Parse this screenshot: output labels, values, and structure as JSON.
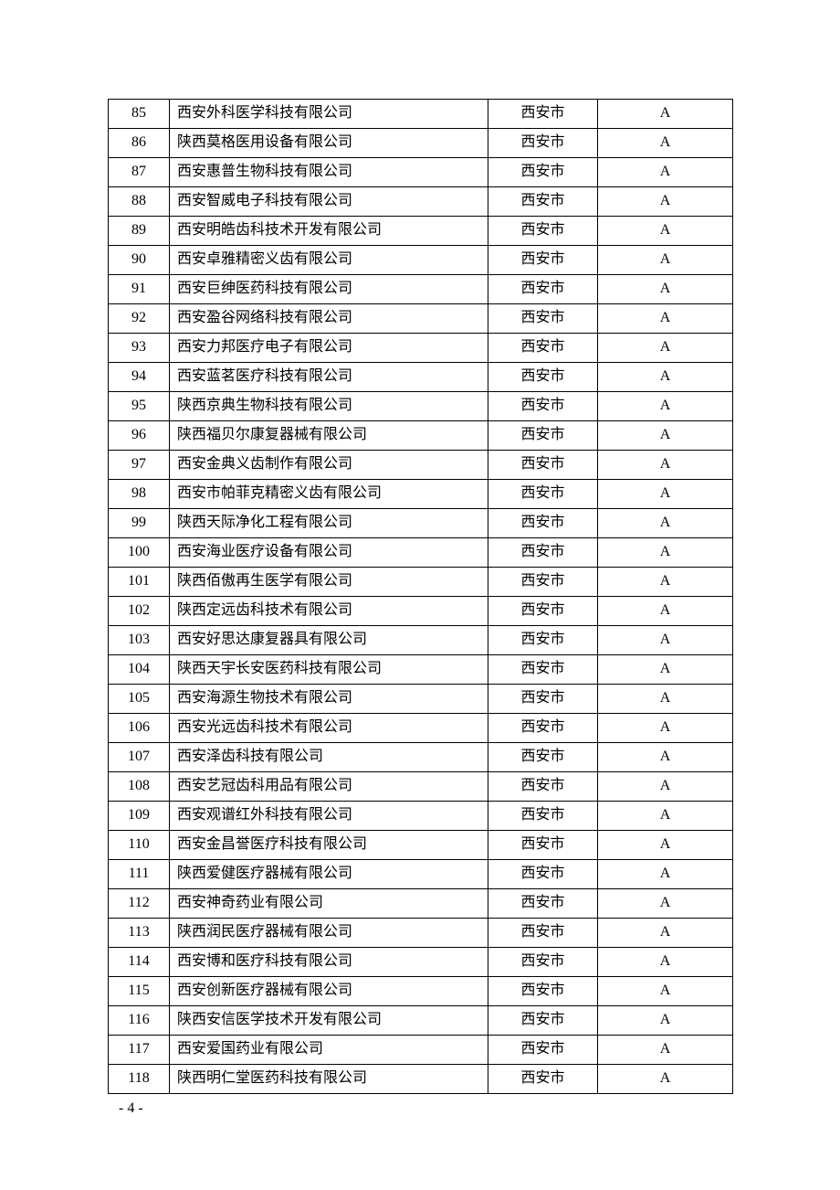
{
  "pageNumber": "- 4 -",
  "rows": [
    {
      "num": "85",
      "name": "西安外科医学科技有限公司",
      "city": "西安市",
      "grade": "A"
    },
    {
      "num": "86",
      "name": "陕西莫格医用设备有限公司",
      "city": "西安市",
      "grade": "A"
    },
    {
      "num": "87",
      "name": "西安惠普生物科技有限公司",
      "city": "西安市",
      "grade": "A"
    },
    {
      "num": "88",
      "name": "西安智威电子科技有限公司",
      "city": "西安市",
      "grade": "A"
    },
    {
      "num": "89",
      "name": "西安明皓齿科技术开发有限公司",
      "city": "西安市",
      "grade": "A"
    },
    {
      "num": "90",
      "name": "西安卓雅精密义齿有限公司",
      "city": "西安市",
      "grade": "A"
    },
    {
      "num": "91",
      "name": "西安巨绅医药科技有限公司",
      "city": "西安市",
      "grade": "A"
    },
    {
      "num": "92",
      "name": "西安盈谷网络科技有限公司",
      "city": "西安市",
      "grade": "A"
    },
    {
      "num": "93",
      "name": "西安力邦医疗电子有限公司",
      "city": "西安市",
      "grade": "A"
    },
    {
      "num": "94",
      "name": "西安蓝茗医疗科技有限公司",
      "city": "西安市",
      "grade": "A"
    },
    {
      "num": "95",
      "name": "陕西京典生物科技有限公司",
      "city": "西安市",
      "grade": "A"
    },
    {
      "num": "96",
      "name": "陕西福贝尔康复器械有限公司",
      "city": "西安市",
      "grade": "A"
    },
    {
      "num": "97",
      "name": "西安金典义齿制作有限公司",
      "city": "西安市",
      "grade": "A"
    },
    {
      "num": "98",
      "name": "西安市帕菲克精密义齿有限公司",
      "city": "西安市",
      "grade": "A"
    },
    {
      "num": "99",
      "name": "陕西天际净化工程有限公司",
      "city": "西安市",
      "grade": "A"
    },
    {
      "num": "100",
      "name": "西安海业医疗设备有限公司",
      "city": "西安市",
      "grade": "A"
    },
    {
      "num": "101",
      "name": "陕西佰傲再生医学有限公司",
      "city": "西安市",
      "grade": "A"
    },
    {
      "num": "102",
      "name": "陕西定远齿科技术有限公司",
      "city": "西安市",
      "grade": "A"
    },
    {
      "num": "103",
      "name": "西安好思达康复器具有限公司",
      "city": "西安市",
      "grade": "A"
    },
    {
      "num": "104",
      "name": "陕西天宇长安医药科技有限公司",
      "city": "西安市",
      "grade": "A"
    },
    {
      "num": "105",
      "name": "西安海源生物技术有限公司",
      "city": "西安市",
      "grade": "A"
    },
    {
      "num": "106",
      "name": "西安光远齿科技术有限公司",
      "city": "西安市",
      "grade": "A"
    },
    {
      "num": "107",
      "name": "西安泽齿科技有限公司",
      "city": "西安市",
      "grade": "A"
    },
    {
      "num": "108",
      "name": "西安艺冠齿科用品有限公司",
      "city": "西安市",
      "grade": "A"
    },
    {
      "num": "109",
      "name": "西安观谱红外科技有限公司",
      "city": "西安市",
      "grade": "A"
    },
    {
      "num": "110",
      "name": "西安金昌誉医疗科技有限公司",
      "city": "西安市",
      "grade": "A"
    },
    {
      "num": "111",
      "name": "陕西爱健医疗器械有限公司",
      "city": "西安市",
      "grade": "A"
    },
    {
      "num": "112",
      "name": "西安神奇药业有限公司",
      "city": "西安市",
      "grade": "A"
    },
    {
      "num": "113",
      "name": "陕西润民医疗器械有限公司",
      "city": "西安市",
      "grade": "A"
    },
    {
      "num": "114",
      "name": "西安博和医疗科技有限公司",
      "city": "西安市",
      "grade": "A"
    },
    {
      "num": "115",
      "name": "西安创新医疗器械有限公司",
      "city": "西安市",
      "grade": "A"
    },
    {
      "num": "116",
      "name": "陕西安信医学技术开发有限公司",
      "city": "西安市",
      "grade": "A"
    },
    {
      "num": "117",
      "name": "西安爱国药业有限公司",
      "city": "西安市",
      "grade": "A"
    },
    {
      "num": "118",
      "name": "陕西明仁堂医药科技有限公司",
      "city": "西安市",
      "grade": "A"
    }
  ]
}
